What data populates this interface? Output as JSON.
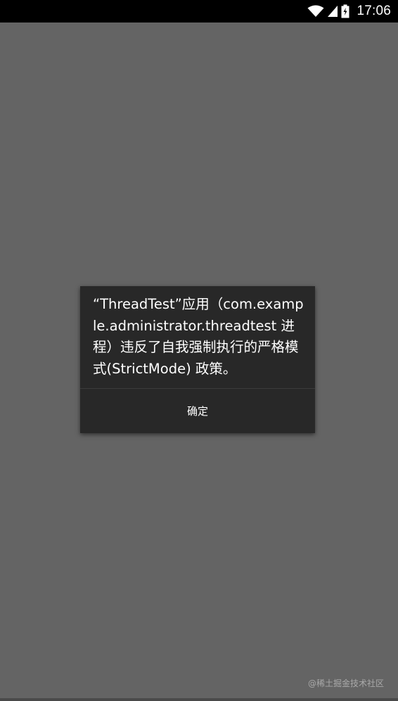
{
  "status_bar": {
    "time": "17:06",
    "icons": [
      "wifi-icon",
      "cell-signal-icon",
      "battery-charging-icon"
    ]
  },
  "dialog": {
    "message": "“ThreadTest”应用（com.example.administrator.threadtest 进程）违反了自我强制执行的严格模式(StrictMode) 政策。",
    "ok_label": "确定"
  },
  "watermark": "@稀土掘金技术社区",
  "colors": {
    "screen_background": "#646464",
    "dialog_background": "#282828",
    "status_bar": "#000000"
  }
}
